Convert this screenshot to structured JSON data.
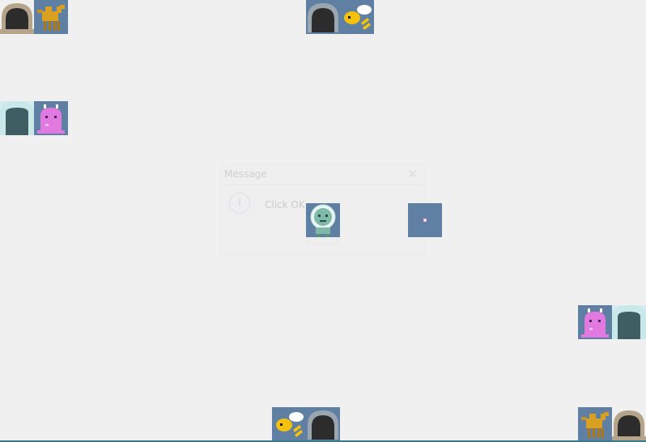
{
  "dialog": {
    "title": "Message",
    "message": "Click OK",
    "close_glyph": "✕",
    "info_glyph": "i"
  },
  "tiles": [
    {
      "kind": "tunnel-dark",
      "icon": "tunnel-icon"
    },
    {
      "kind": "camel",
      "icon": "camel-icon"
    },
    {
      "kind": "tunnel-blue",
      "icon": "tunnel-icon"
    },
    {
      "kind": "bee",
      "icon": "bee-icon"
    },
    {
      "kind": "door-ice",
      "icon": "door-icon"
    },
    {
      "kind": "pink-blob",
      "icon": "alien-icon"
    },
    {
      "kind": "astronaut",
      "icon": "astronaut-icon"
    },
    {
      "kind": "pink-blob",
      "icon": "alien-icon"
    },
    {
      "kind": "door-ice",
      "icon": "door-icon"
    },
    {
      "kind": "bee",
      "icon": "bee-icon"
    },
    {
      "kind": "tunnel-blue",
      "icon": "tunnel-icon"
    },
    {
      "kind": "camel",
      "icon": "camel-icon"
    },
    {
      "kind": "tunnel-dark",
      "icon": "tunnel-icon"
    }
  ],
  "colors": {
    "background": "#f0f0f0",
    "tile_blue": "#5f7fa3",
    "bottom_line": "#3c7b8a"
  }
}
